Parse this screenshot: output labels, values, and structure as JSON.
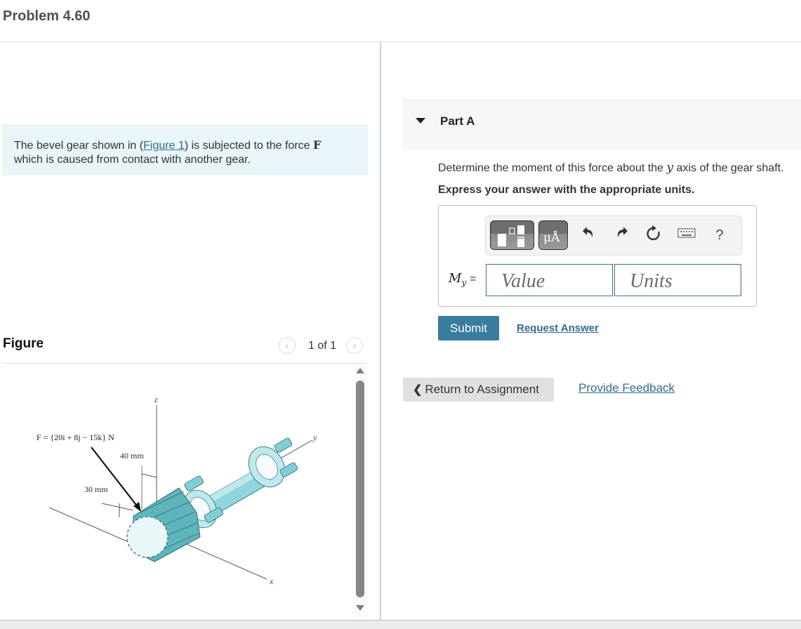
{
  "header": {
    "title": "Problem 4.60"
  },
  "intro": {
    "text_before": "The bevel gear shown in (",
    "figure_link": "Figure 1",
    "text_after": ") is subjected to the force ",
    "force_symbol": "F",
    "text_line2": "which is caused from contact with another gear."
  },
  "figure_panel": {
    "label": "Figure",
    "counter": "1 of 1",
    "prev_icon": "chevron-left-icon",
    "next_icon": "chevron-right-icon",
    "image": {
      "force_label": "F = {20i + 8j − 15k} N",
      "dim_40": "40 mm",
      "dim_30": "30 mm",
      "axis_x": "x",
      "axis_y": "y",
      "axis_z": "z"
    }
  },
  "part_a": {
    "label": "Part A",
    "question": "Determine the moment of this force about the ",
    "question_var": "y",
    "question_end": " axis of the gear shaft.",
    "instruction": "Express your answer with the appropriate units.",
    "toolbar": {
      "templates_icon": "templates-icon",
      "units_label": "μÅ",
      "undo_icon": "undo-icon",
      "redo_icon": "redo-icon",
      "reset_icon": "reset-icon",
      "keyboard_icon": "keyboard-icon",
      "help_label": "?"
    },
    "answer_label_main": "M",
    "answer_label_sub": "y",
    "answer_eq": "=",
    "value_placeholder": "Value",
    "value": "",
    "units_placeholder": "Units",
    "units": "",
    "submit_label": "Submit",
    "request_answer_label": "Request Answer"
  },
  "footer": {
    "return_label": "Return to Assignment",
    "feedback_label": "Provide Feedback"
  },
  "colors": {
    "accent": "#3a7ca0",
    "link": "#2f6d92",
    "intro_bg": "#e9f5f8",
    "gear": "#7fcfd6"
  }
}
